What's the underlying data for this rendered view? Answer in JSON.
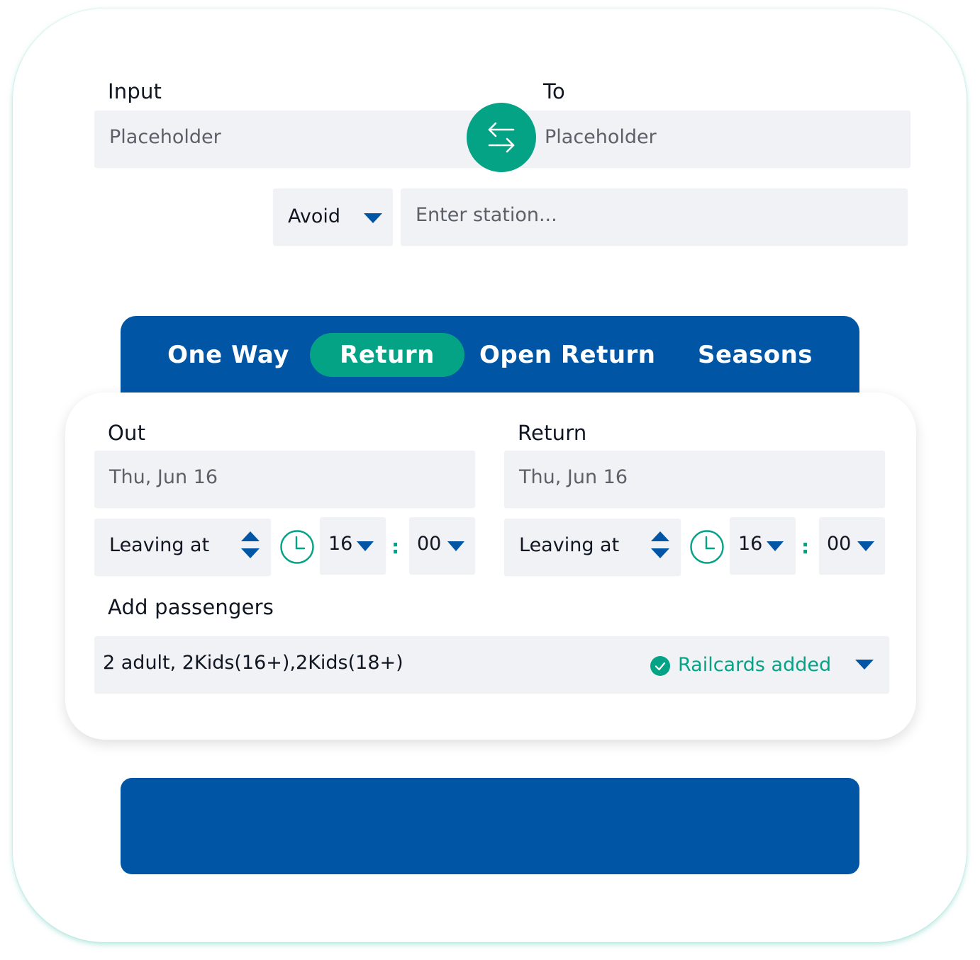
{
  "journey": {
    "from_label": "Input",
    "from_placeholder": "Placeholder",
    "to_label": "To",
    "to_placeholder": "Placeholder",
    "avoid_label": "Avoid",
    "station_placeholder": "Enter station..."
  },
  "tabs": [
    {
      "label": "One Way",
      "active": false
    },
    {
      "label": "Return",
      "active": true
    },
    {
      "label": "Open Return",
      "active": false
    },
    {
      "label": "Seasons",
      "active": false
    }
  ],
  "out": {
    "label": "Out",
    "date": "Thu, Jun 16",
    "time_mode": "Leaving at",
    "hour": "16",
    "separator": ":",
    "minute": "00"
  },
  "return": {
    "label": "Return",
    "date": "Thu, Jun 16",
    "time_mode": "Leaving at",
    "hour": "16",
    "separator": ":",
    "minute": "00"
  },
  "passengers": {
    "label": "Add passengers",
    "summary": "2 adult, 2Kids(16+),2Kids(18+)",
    "railcards": "Railcards added"
  },
  "colors": {
    "primary": "#0055a5",
    "accent": "#05a386",
    "field_bg": "#f1f2f5"
  },
  "icons": {
    "swap": "swap-arrows-icon",
    "dropdown": "chevron-down-icon",
    "stepper": "up-down-stepper-icon",
    "clock": "clock-icon",
    "check": "check-circle-icon"
  }
}
